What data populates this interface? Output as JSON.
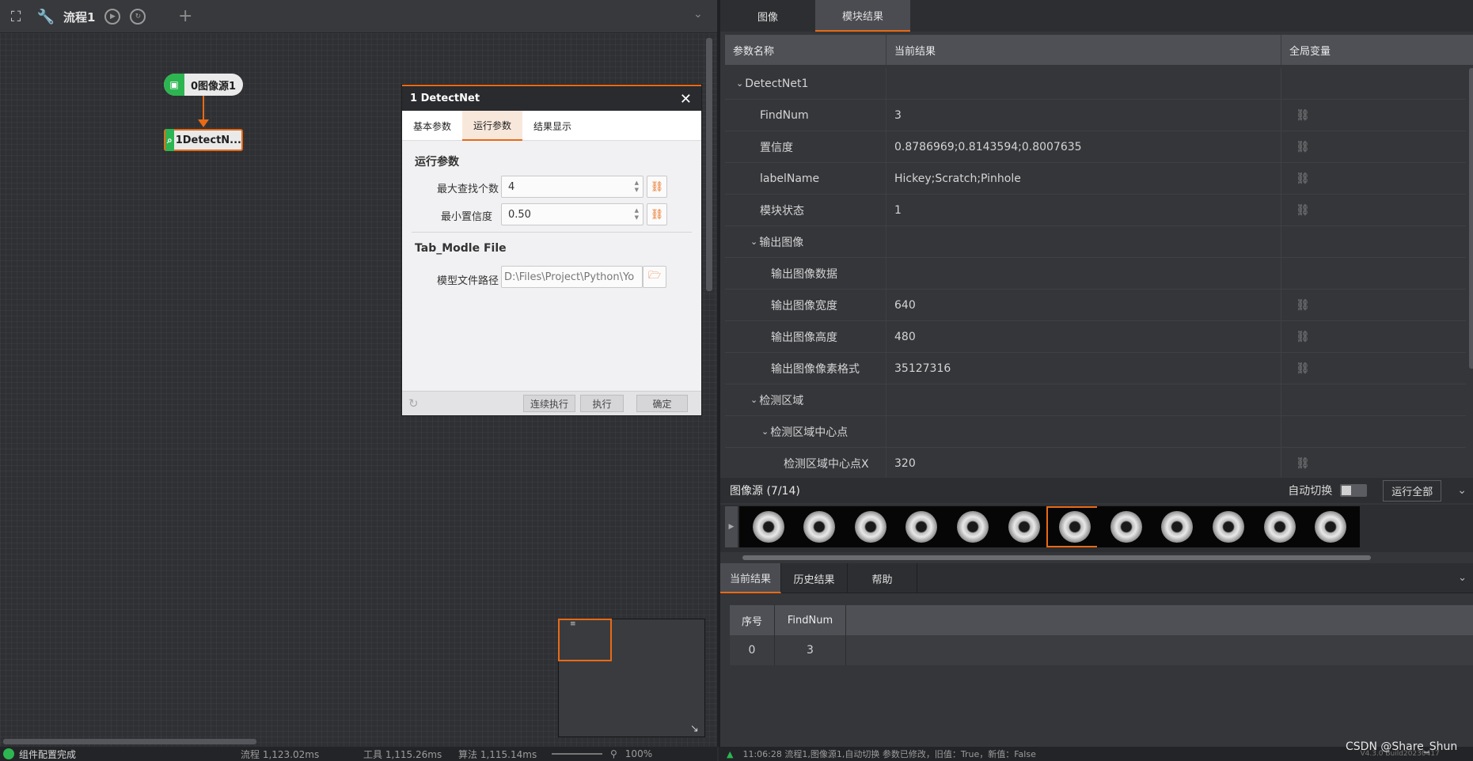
{
  "toolbar": {
    "flow_tab": "流程1",
    "add": "+"
  },
  "nodes": {
    "node0": "0图像源1",
    "node1": "1DetectN..."
  },
  "dialog": {
    "title": "1 DetectNet",
    "tabs": [
      "基本参数",
      "运行参数",
      "结果显示"
    ],
    "section_run": "运行参数",
    "max_find_label": "最大查找个数",
    "max_find_value": "4",
    "min_conf_label": "最小置信度",
    "min_conf_value": "0.50",
    "section_model": "Tab_Modle File",
    "model_path_label": "模型文件路径",
    "model_path_value": "D:\\Files\\Project\\Python\\Yo",
    "btn_continuous": "连续执行",
    "btn_run": "执行",
    "btn_ok": "确定"
  },
  "status": {
    "message": "组件配置完成",
    "flow_time": "流程 1,123.02ms",
    "tool_time": "工具 1,115.26ms",
    "algo_time": "算法 1,115.14ms",
    "zoom": "100%",
    "log": "11:06:28  流程1,图像源1,自动切换 参数已修改，旧值：True，新值：False",
    "version": "V4.3.0 Build20230417"
  },
  "right": {
    "tabs": [
      "图像",
      "模块结果"
    ],
    "headers": [
      "参数名称",
      "当前结果",
      "全局变量"
    ],
    "rows": [
      {
        "name": "DetectNet1",
        "value": "",
        "indent": 0,
        "expand": true,
        "link": false
      },
      {
        "name": "FindNum",
        "value": "3",
        "indent": 1,
        "expand": false,
        "link": true
      },
      {
        "name": "置信度",
        "value": "0.8786969;0.8143594;0.8007635",
        "indent": 1,
        "expand": false,
        "link": true
      },
      {
        "name": "labelName",
        "value": "Hickey;Scratch;Pinhole",
        "indent": 1,
        "expand": false,
        "link": true
      },
      {
        "name": "模块状态",
        "value": "1",
        "indent": 1,
        "expand": false,
        "link": true
      },
      {
        "name": "输出图像",
        "value": "",
        "indent": 1,
        "expand": true,
        "link": false
      },
      {
        "name": "输出图像数据",
        "value": "",
        "indent": 2,
        "expand": false,
        "link": false
      },
      {
        "name": "输出图像宽度",
        "value": "640",
        "indent": 2,
        "expand": false,
        "link": true
      },
      {
        "name": "输出图像高度",
        "value": "480",
        "indent": 2,
        "expand": false,
        "link": true
      },
      {
        "name": "输出图像像素格式",
        "value": "35127316",
        "indent": 2,
        "expand": false,
        "link": true
      },
      {
        "name": "检测区域",
        "value": "",
        "indent": 1,
        "expand": true,
        "link": false
      },
      {
        "name": "检测区域中心点",
        "value": "",
        "indent": 2,
        "expand": true,
        "link": false
      },
      {
        "name": "检测区域中心点X",
        "value": "320",
        "indent": 3,
        "expand": false,
        "link": true
      }
    ],
    "image_source_label": "图像源 (7/14)",
    "auto_switch_label": "自动切换",
    "run_all": "运行全部",
    "thumb_count": 12,
    "selected_thumb": 6,
    "bottom_tabs": [
      "当前结果",
      "历史结果",
      "帮助"
    ],
    "bottom_headers": [
      "序号",
      "FindNum"
    ],
    "bottom_row": [
      "0",
      "3"
    ],
    "watermark": "CSDN @Share_Shun"
  }
}
